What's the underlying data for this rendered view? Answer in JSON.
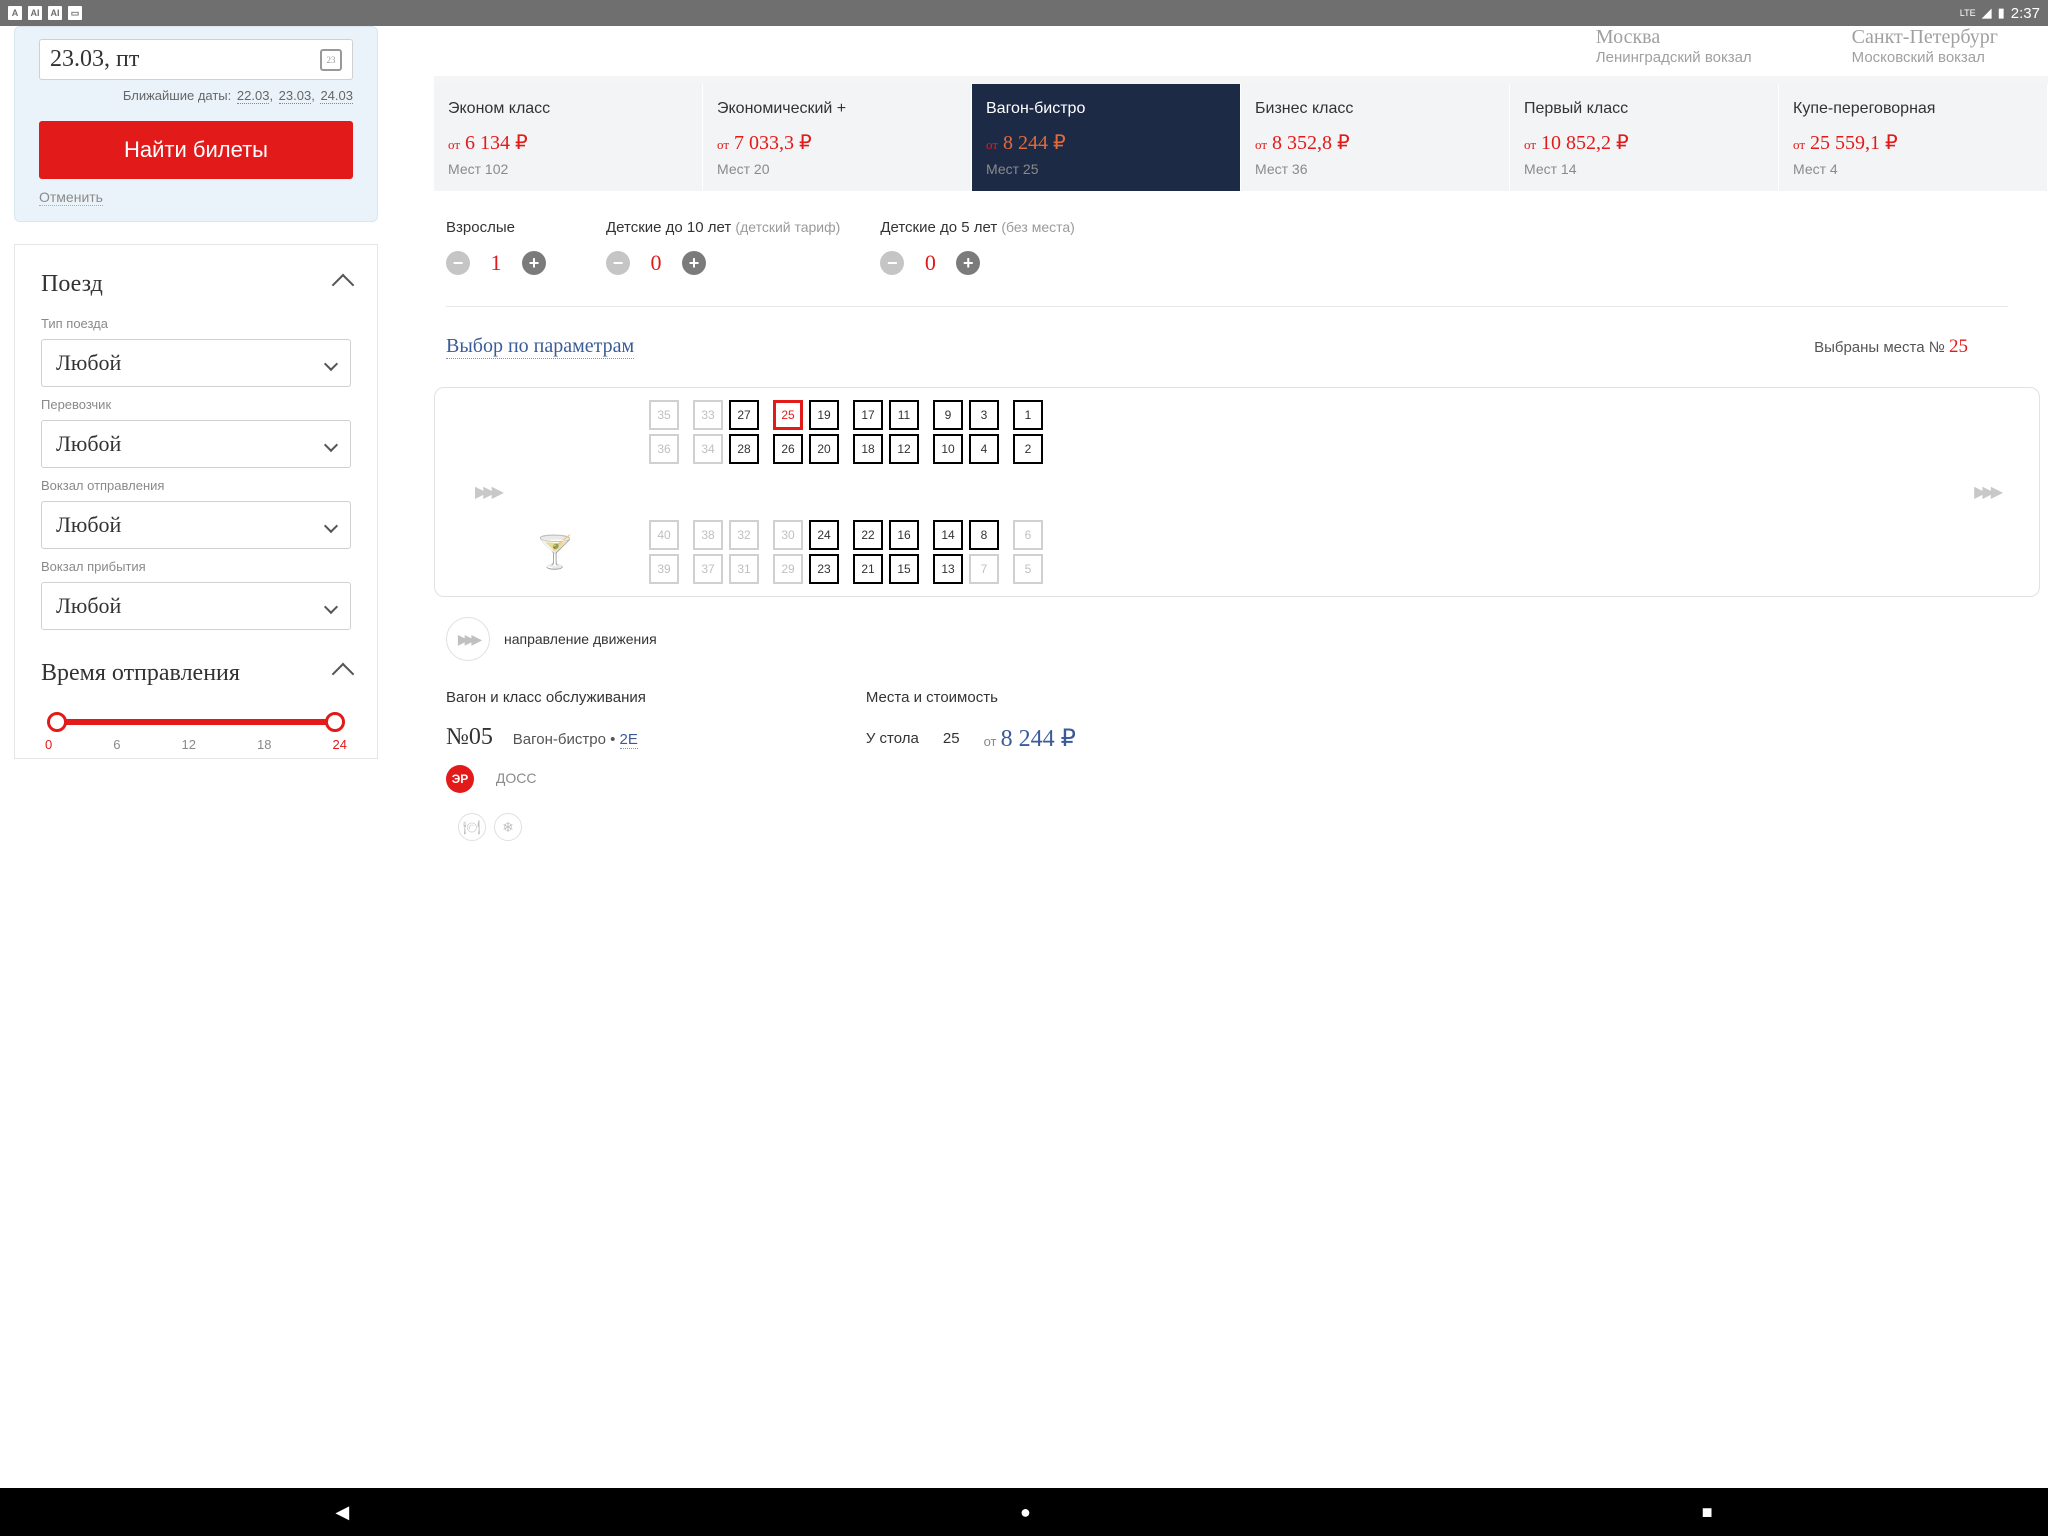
{
  "statusbar": {
    "time": "2:37",
    "lte": "LTE"
  },
  "search": {
    "date_display": "23.03, пт",
    "nearest_label": "Ближайшие даты:",
    "nearest_dates": [
      "22.03",
      "23.03",
      "24.03"
    ],
    "btn_label": "Найти билеты",
    "cancel": "Отменить"
  },
  "filters": {
    "train_section": "Поезд",
    "train_type_label": "Тип поезда",
    "train_type_value": "Любой",
    "carrier_label": "Перевозчик",
    "carrier_value": "Любой",
    "depart_station_label": "Вокзал отправления",
    "depart_station_value": "Любой",
    "arrive_station_label": "Вокзал прибытия",
    "arrive_station_value": "Любой",
    "time_section": "Время отправления",
    "slider_ticks": [
      "0",
      "6",
      "12",
      "18",
      "24"
    ]
  },
  "route": {
    "from_city": "Москва",
    "from_station": "Ленинградский вокзал",
    "to_city": "Санкт-Петербург",
    "to_station": "Московский вокзал"
  },
  "classes": [
    {
      "title": "Эконом класс",
      "from": "от",
      "price": "6 134 ₽",
      "seats": "Мест 102"
    },
    {
      "title": "Экономический +",
      "from": "от",
      "price": "7 033,3 ₽",
      "seats": "Мест 20"
    },
    {
      "title": "Вагон-бистро",
      "from": "от",
      "price": "8 244 ₽",
      "seats": "Мест 25"
    },
    {
      "title": "Бизнес класс",
      "from": "от",
      "price": "8 352,8 ₽",
      "seats": "Мест 36"
    },
    {
      "title": "Первый класс",
      "from": "от",
      "price": "10 852,2 ₽",
      "seats": "Мест 14"
    },
    {
      "title": "Купе-переговорная",
      "from": "от",
      "price": "25 559,1 ₽",
      "seats": "Мест 4"
    }
  ],
  "passengers": {
    "adults_label": "Взрослые",
    "adults_value": "1",
    "children_label": "Детские до 10 лет",
    "children_hint": "(детский тариф)",
    "children_value": "0",
    "infants_label": "Детские до 5 лет",
    "infants_hint": "(без места)",
    "infants_value": "0"
  },
  "seatsel": {
    "param_link": "Выбор по параметрам",
    "selected_label": "Выбраны места №",
    "selected_num": "25",
    "direction_label": "направление движения"
  },
  "deck_top": {
    "pairs": [
      {
        "t": "35",
        "b": "36",
        "st": "taken",
        "sb": "taken"
      },
      {
        "t": "33",
        "b": "34",
        "st": "taken",
        "sb": "taken"
      },
      {
        "t": "27",
        "b": "28",
        "st": "avail",
        "sb": "avail"
      },
      {
        "t": "25",
        "b": "26",
        "st": "selected",
        "sb": "avail"
      },
      {
        "t": "19",
        "b": "20",
        "st": "avail",
        "sb": "avail"
      },
      {
        "t": "17",
        "b": "18",
        "st": "avail",
        "sb": "avail"
      },
      {
        "t": "11",
        "b": "12",
        "st": "avail",
        "sb": "avail"
      },
      {
        "t": "9",
        "b": "10",
        "st": "avail",
        "sb": "avail"
      },
      {
        "t": "3",
        "b": "4",
        "st": "avail",
        "sb": "avail"
      },
      {
        "t": "1",
        "b": "2",
        "st": "avail",
        "sb": "avail"
      }
    ]
  },
  "deck_bottom": {
    "pairs": [
      {
        "t": "40",
        "b": "39",
        "st": "taken",
        "sb": "taken"
      },
      {
        "t": "38",
        "b": "37",
        "st": "taken",
        "sb": "taken"
      },
      {
        "t": "32",
        "b": "31",
        "st": "taken",
        "sb": "taken"
      },
      {
        "t": "30",
        "b": "29",
        "st": "taken",
        "sb": "taken"
      },
      {
        "t": "24",
        "b": "23",
        "st": "avail",
        "sb": "avail"
      },
      {
        "t": "22",
        "b": "21",
        "st": "avail",
        "sb": "avail"
      },
      {
        "t": "16",
        "b": "15",
        "st": "avail",
        "sb": "avail"
      },
      {
        "t": "14",
        "b": "13",
        "st": "avail",
        "sb": "avail"
      },
      {
        "t": "8",
        "b": "7",
        "st": "avail",
        "sb": "taken"
      },
      {
        "t": "6",
        "b": "5",
        "st": "taken",
        "sb": "taken"
      }
    ]
  },
  "carinfo": {
    "heading_left": "Вагон и класс обслуживания",
    "heading_right": "Места и стоимость",
    "car_no": "№05",
    "car_class": "Вагон-бистро",
    "car_class_link": "2Е",
    "er": "ЭР",
    "doss": "ДОСС",
    "place_label": "У стола",
    "place_num": "25",
    "from": "от",
    "price": "8 244 ₽"
  }
}
